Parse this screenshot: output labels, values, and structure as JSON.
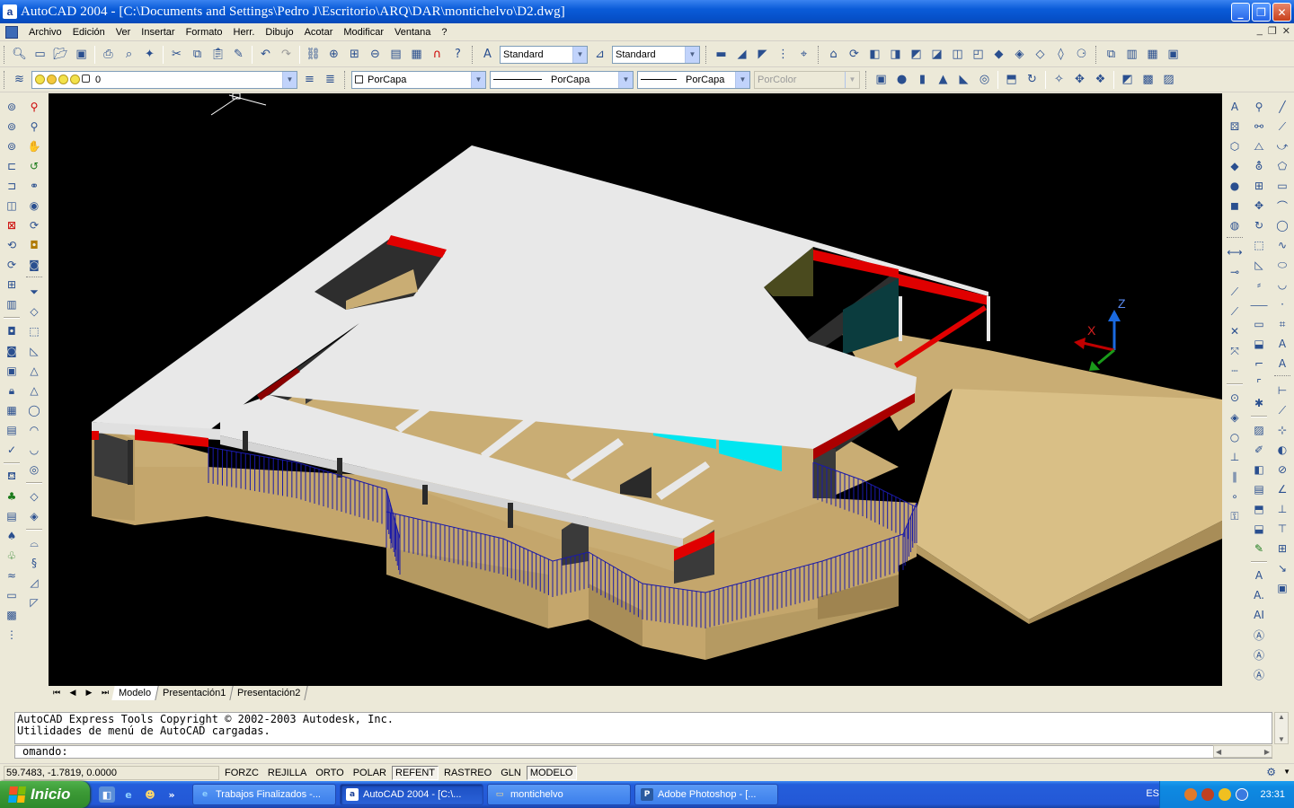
{
  "window": {
    "title": "AutoCAD 2004 - [C:\\Documents and Settings\\Pedro J\\Escritorio\\ARQ\\DAR\\montichelvo\\D2.dwg]",
    "app_icon_letter": "a",
    "minimize": "_",
    "restore": "❐",
    "close": "✕"
  },
  "menu": {
    "items": [
      "Archivo",
      "Edición",
      "Ver",
      "Insertar",
      "Formato",
      "Herr.",
      "Dibujo",
      "Acotar",
      "Modificar",
      "Ventana",
      "?"
    ],
    "mdi_controls": [
      "_",
      "❐",
      "✕"
    ]
  },
  "toolbar": {
    "text_style": "Standard",
    "dim_style": "Standard",
    "layer_value": "0",
    "color": "PorCapa",
    "linetype": "PorCapa",
    "lineweight": "PorCapa",
    "plotstyle": "PorColor"
  },
  "viewport": {
    "ucs_x": "X",
    "ucs_z": "Z",
    "colors": {
      "background": "#000000",
      "slab": "#e8e8e8",
      "terrain": "#c9ad74",
      "accent_red": "#e00000",
      "glass": "#00e6f0",
      "railing": "#1a1aa8"
    }
  },
  "layout_tabs": {
    "tabs": [
      "Modelo",
      "Presentación1",
      "Presentación2"
    ],
    "active": "Modelo"
  },
  "command": {
    "lines": [
      "AutoCAD Express Tools Copyright © 2002-2003 Autodesk, Inc.",
      "Utilidades de menú de AutoCAD cargadas."
    ],
    "prompt": "omando:"
  },
  "status": {
    "coordinates": "59.7483, -1.7819, 0.0000",
    "toggles": [
      {
        "label": "FORZC",
        "on": false
      },
      {
        "label": "REJILLA",
        "on": false
      },
      {
        "label": "ORTO",
        "on": false
      },
      {
        "label": "POLAR",
        "on": false
      },
      {
        "label": "REFENT",
        "on": true
      },
      {
        "label": "RASTREO",
        "on": false
      },
      {
        "label": "GLN",
        "on": false
      },
      {
        "label": "MODELO",
        "on": true
      }
    ]
  },
  "taskbar": {
    "start_label": "Inicio",
    "items": [
      {
        "label": "Trabajos Finalizados -...",
        "active": false,
        "icon": "e"
      },
      {
        "label": "AutoCAD 2004 - [C:\\...",
        "active": true,
        "icon": "a"
      },
      {
        "label": "montichelvo",
        "active": false,
        "icon": "▭"
      },
      {
        "label": "Adobe Photoshop - [...",
        "active": false,
        "icon": "P"
      }
    ],
    "language": "ES",
    "clock": "23:31"
  }
}
